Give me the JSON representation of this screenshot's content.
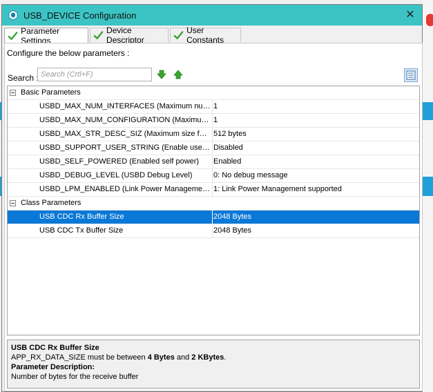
{
  "window": {
    "title": "USB_DEVICE Configuration",
    "close_glyph": "✕"
  },
  "tabs": [
    {
      "label": "Parameter Settings",
      "active": true
    },
    {
      "label": "Device Descriptor",
      "active": false
    },
    {
      "label": "User Constants",
      "active": false
    }
  ],
  "panel": {
    "configure_label": "Configure the below parameters :",
    "search_label": "Search :",
    "search_placeholder": "Search (Crtl+F)",
    "search_value": ""
  },
  "groups": [
    {
      "name": "Basic Parameters",
      "rows": [
        {
          "name": "USBD_MAX_NUM_INTERFACES (Maximum numbe...",
          "value": "1"
        },
        {
          "name": "USBD_MAX_NUM_CONFIGURATION (Maximum n...",
          "value": "1"
        },
        {
          "name": "USBD_MAX_STR_DESC_SIZ (Maximum size for th...",
          "value": "512 bytes"
        },
        {
          "name": "USBD_SUPPORT_USER_STRING (Enable user stri...",
          "value": "Disabled"
        },
        {
          "name": "USBD_SELF_POWERED (Enabled self power)",
          "value": "Enabled"
        },
        {
          "name": "USBD_DEBUG_LEVEL (USBD Debug Level)",
          "value": "0: No debug message"
        },
        {
          "name": "USBD_LPM_ENABLED (Link Power Management)",
          "value": "1: Link Power Management supported"
        }
      ]
    },
    {
      "name": "Class Parameters",
      "rows": [
        {
          "name": "USB CDC Rx Buffer Size",
          "value": "2048 Bytes",
          "selected": true
        },
        {
          "name": "USB CDC Tx Buffer Size",
          "value": "2048 Bytes"
        }
      ]
    }
  ],
  "description": {
    "title": "USB CDC Rx Buffer Size",
    "line_prefix": "APP_RX_DATA_SIZE must be between ",
    "min": "4 Bytes",
    "and": " and ",
    "max": "2 KBytes",
    "line_suffix": ".",
    "param_desc_label": "Parameter Description:",
    "param_desc_text": "Number of bytes for the receive buffer"
  },
  "colors": {
    "titlebar": "#3cc4c4",
    "selection": "#0a78d7",
    "check_green": "#2e9e2e"
  },
  "icons": {
    "app": "stm32cube-icon",
    "tab_check": "green-check-icon",
    "next": "arrow-down-green-icon",
    "prev": "arrow-up-green-icon",
    "view": "list-view-icon"
  }
}
